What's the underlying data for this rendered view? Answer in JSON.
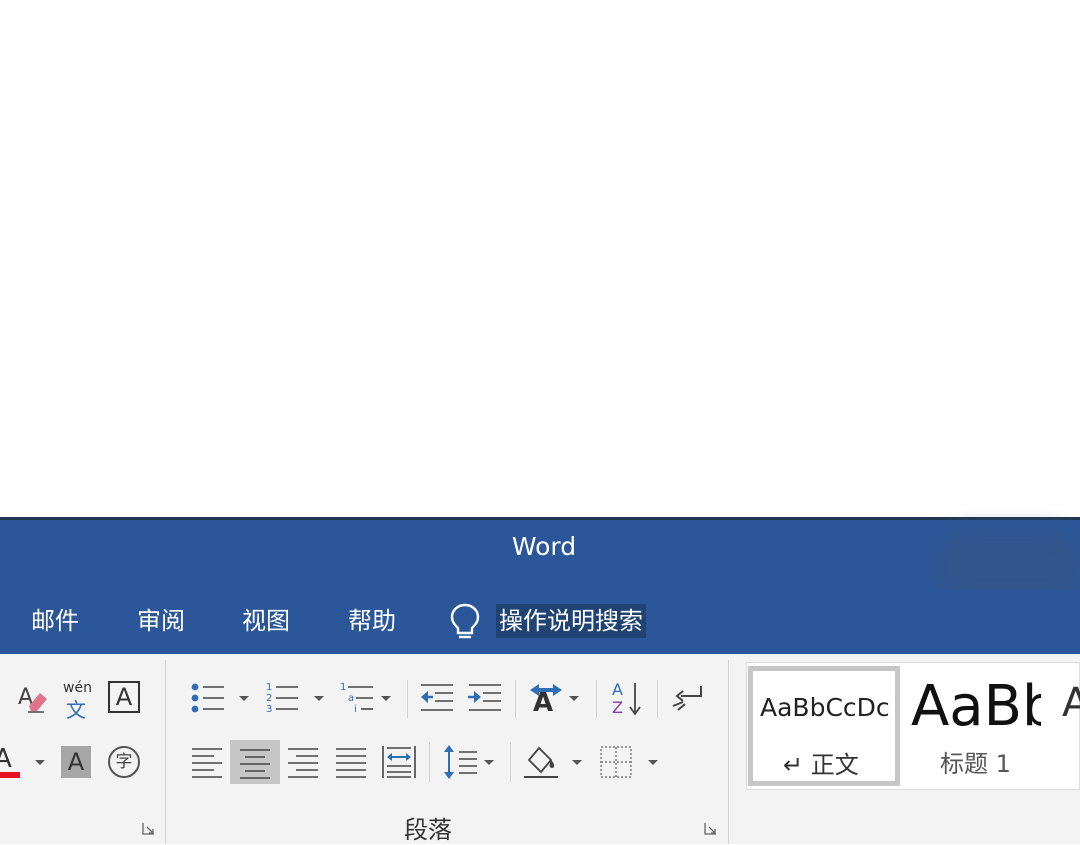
{
  "window": {
    "title": "Word"
  },
  "menu": {
    "items": [
      {
        "label": "邮件"
      },
      {
        "label": "审阅"
      },
      {
        "label": "视图"
      },
      {
        "label": "帮助"
      }
    ],
    "search_label": "操作说明搜索"
  },
  "ribbon": {
    "font_group": {
      "pinyin_top": "wén",
      "pinyin_bottom": "文",
      "char_border": "A",
      "char_shading": "A",
      "enclose_char": "字"
    },
    "paragraph_group": {
      "label": "段落"
    },
    "styles_group": {
      "styles": [
        {
          "preview": "AaBbCcDc",
          "name": "↵ 正文",
          "selected": true
        },
        {
          "preview": "AaBb",
          "name": "标题 1",
          "selected": false
        }
      ]
    }
  },
  "colors": {
    "title_bar": "#2b579a",
    "ribbon_bg": "#f3f3f3",
    "font_color_underline": "#e81123",
    "icon_blue": "#2f6db5"
  }
}
